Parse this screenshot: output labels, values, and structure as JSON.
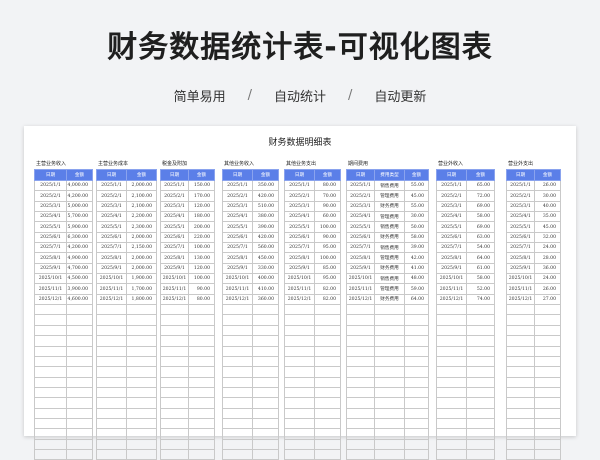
{
  "banner": {
    "title": "财务数据统计表-可视化图表",
    "tags": [
      "简单易用",
      "自动统计",
      "自动更新"
    ],
    "separator": "/"
  },
  "sheet": {
    "title": "财务数据明细表",
    "header_color": "#5b7fe8",
    "tables": [
      {
        "title": "主营业务收入",
        "cols": [
          "日期",
          "金额"
        ],
        "rows": [
          [
            "2025/1/1",
            "4,000.00"
          ],
          [
            "2025/2/1",
            "4,200.00"
          ],
          [
            "2025/3/1",
            "5,000.00"
          ],
          [
            "2025/4/1",
            "5,700.00"
          ],
          [
            "2025/5/1",
            "5,900.00"
          ],
          [
            "2025/6/1",
            "6,300.00"
          ],
          [
            "2025/7/1",
            "4,200.00"
          ],
          [
            "2025/8/1",
            "4,900.00"
          ],
          [
            "2025/9/1",
            "4,700.00"
          ],
          [
            "2025/10/1",
            "4,500.00"
          ],
          [
            "2025/11/1",
            "3,900.00"
          ],
          [
            "2025/12/1",
            "4,600.00"
          ]
        ]
      },
      {
        "title": "主营业务成本",
        "cols": [
          "日期",
          "金额"
        ],
        "rows": [
          [
            "2025/1/1",
            "2,000.00"
          ],
          [
            "2025/2/1",
            "2,100.00"
          ],
          [
            "2025/3/1",
            "2,100.00"
          ],
          [
            "2025/4/1",
            "2,200.00"
          ],
          [
            "2025/5/1",
            "2,300.00"
          ],
          [
            "2025/6/1",
            "2,000.00"
          ],
          [
            "2025/7/1",
            "2,150.00"
          ],
          [
            "2025/8/1",
            "2,000.00"
          ],
          [
            "2025/9/1",
            "2,000.00"
          ],
          [
            "2025/10/1",
            "1,900.00"
          ],
          [
            "2025/11/1",
            "1,700.00"
          ],
          [
            "2025/12/1",
            "1,800.00"
          ]
        ]
      },
      {
        "title": "税金及附加",
        "cols": [
          "日期",
          "金额"
        ],
        "rows": [
          [
            "2025/1/1",
            "150.00"
          ],
          [
            "2025/2/1",
            "170.00"
          ],
          [
            "2025/3/1",
            "120.00"
          ],
          [
            "2025/4/1",
            "180.00"
          ],
          [
            "2025/5/1",
            "200.00"
          ],
          [
            "2025/6/1",
            "220.00"
          ],
          [
            "2025/7/1",
            "100.00"
          ],
          [
            "2025/8/1",
            "130.00"
          ],
          [
            "2025/9/1",
            "120.00"
          ],
          [
            "2025/10/1",
            "100.00"
          ],
          [
            "2025/11/1",
            "90.00"
          ],
          [
            "2025/12/1",
            "80.00"
          ]
        ]
      },
      {
        "title": "其他业务收入",
        "cols": [
          "日期",
          "金额"
        ],
        "rows": [
          [
            "2025/1/1",
            "350.00"
          ],
          [
            "2025/2/1",
            "420.00"
          ],
          [
            "2025/3/1",
            "510.00"
          ],
          [
            "2025/4/1",
            "380.00"
          ],
          [
            "2025/5/1",
            "390.00"
          ],
          [
            "2025/6/1",
            "420.00"
          ],
          [
            "2025/7/1",
            "560.00"
          ],
          [
            "2025/8/1",
            "450.00"
          ],
          [
            "2025/9/1",
            "330.00"
          ],
          [
            "2025/10/1",
            "400.00"
          ],
          [
            "2025/11/1",
            "410.00"
          ],
          [
            "2025/12/1",
            "360.00"
          ]
        ]
      },
      {
        "title": "其他业务支出",
        "cols": [
          "日期",
          "金额"
        ],
        "rows": [
          [
            "2025/1/1",
            "80.00"
          ],
          [
            "2025/2/1",
            "70.00"
          ],
          [
            "2025/3/1",
            "90.00"
          ],
          [
            "2025/4/1",
            "60.00"
          ],
          [
            "2025/5/1",
            "100.00"
          ],
          [
            "2025/6/1",
            "90.00"
          ],
          [
            "2025/7/1",
            "95.00"
          ],
          [
            "2025/8/1",
            "100.00"
          ],
          [
            "2025/9/1",
            "85.00"
          ],
          [
            "2025/10/1",
            "95.00"
          ],
          [
            "2025/11/1",
            "82.00"
          ],
          [
            "2025/12/1",
            "82.00"
          ]
        ]
      },
      {
        "title": "期间费用",
        "cols": [
          "日期",
          "费用类型",
          "金额"
        ],
        "rows": [
          [
            "2025/1/1",
            "销售费用",
            "55.00"
          ],
          [
            "2025/2/1",
            "管理费用",
            "45.00"
          ],
          [
            "2025/3/1",
            "财务费用",
            "55.00"
          ],
          [
            "2025/4/1",
            "管理费用",
            "30.00"
          ],
          [
            "2025/5/1",
            "销售费用",
            "50.00"
          ],
          [
            "2025/6/1",
            "财务费用",
            "58.00"
          ],
          [
            "2025/7/1",
            "销售费用",
            "39.00"
          ],
          [
            "2025/8/1",
            "管理费用",
            "42.00"
          ],
          [
            "2025/9/1",
            "财务费用",
            "41.00"
          ],
          [
            "2025/10/1",
            "销售费用",
            "48.00"
          ],
          [
            "2025/11/1",
            "管理费用",
            "59.00"
          ],
          [
            "2025/12/1",
            "财务费用",
            "64.00"
          ]
        ]
      },
      {
        "title": "营业外收入",
        "cols": [
          "日期",
          "金额"
        ],
        "rows": [
          [
            "2025/1/1",
            "65.00"
          ],
          [
            "2025/2/1",
            "72.00"
          ],
          [
            "2025/3/1",
            "69.00"
          ],
          [
            "2025/4/1",
            "58.00"
          ],
          [
            "2025/5/1",
            "69.00"
          ],
          [
            "2025/6/1",
            "63.00"
          ],
          [
            "2025/7/1",
            "54.00"
          ],
          [
            "2025/8/1",
            "64.00"
          ],
          [
            "2025/9/1",
            "61.00"
          ],
          [
            "2025/10/1",
            "58.00"
          ],
          [
            "2025/11/1",
            "52.00"
          ],
          [
            "2025/12/1",
            "74.00"
          ]
        ]
      },
      {
        "title": "营业外支出",
        "cols": [
          "日期",
          "金额"
        ],
        "rows": [
          [
            "2025/1/1",
            "26.00"
          ],
          [
            "2025/2/1",
            "30.00"
          ],
          [
            "2025/3/1",
            "40.00"
          ],
          [
            "2025/4/1",
            "35.00"
          ],
          [
            "2025/5/1",
            "45.00"
          ],
          [
            "2025/6/1",
            "32.00"
          ],
          [
            "2025/7/1",
            "24.00"
          ],
          [
            "2025/8/1",
            "28.00"
          ],
          [
            "2025/9/1",
            "36.00"
          ],
          [
            "2025/10/1",
            "24.00"
          ],
          [
            "2025/11/1",
            "26.00"
          ],
          [
            "2025/12/1",
            "27.00"
          ]
        ]
      }
    ]
  }
}
